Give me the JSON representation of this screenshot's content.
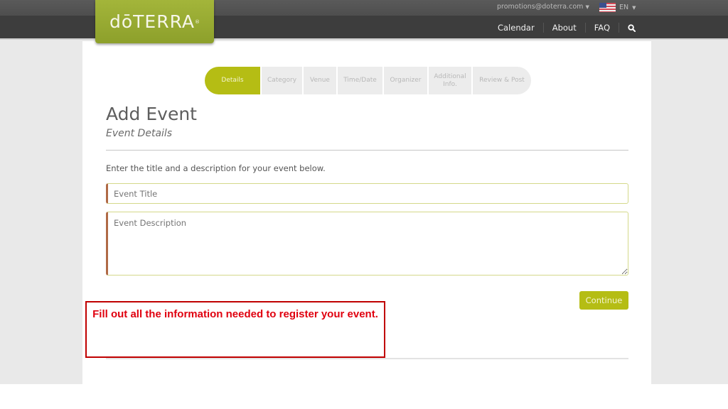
{
  "header": {
    "logo_text": "dōTERRA",
    "logo_mark": "®",
    "account_email": "promotions@doterra.com",
    "language": "EN",
    "nav": [
      "Calendar",
      "About",
      "FAQ"
    ],
    "search_icon": "search-icon",
    "brand_color": "#9aad32"
  },
  "wizard": {
    "steps": [
      {
        "label": "Details",
        "active": true
      },
      {
        "label": "Category",
        "active": false
      },
      {
        "label": "Venue",
        "active": false
      },
      {
        "label": "Time/Date",
        "active": false
      },
      {
        "label": "Organizer",
        "active": false
      },
      {
        "label": "Additional Info.",
        "active": false
      },
      {
        "label": "Review & Post",
        "active": false
      }
    ],
    "accent_color": "#b5bd14"
  },
  "form": {
    "title": "Add Event",
    "subtitle": "Event Details",
    "instructions": "Enter the title and a description for your event below.",
    "title_placeholder": "Event Title",
    "title_value": "",
    "description_placeholder": "Event Description",
    "description_value": "",
    "continue_label": "Continue"
  },
  "callout": {
    "text": "Fill out all the information needed to register your event.",
    "color": "#e0000f"
  }
}
